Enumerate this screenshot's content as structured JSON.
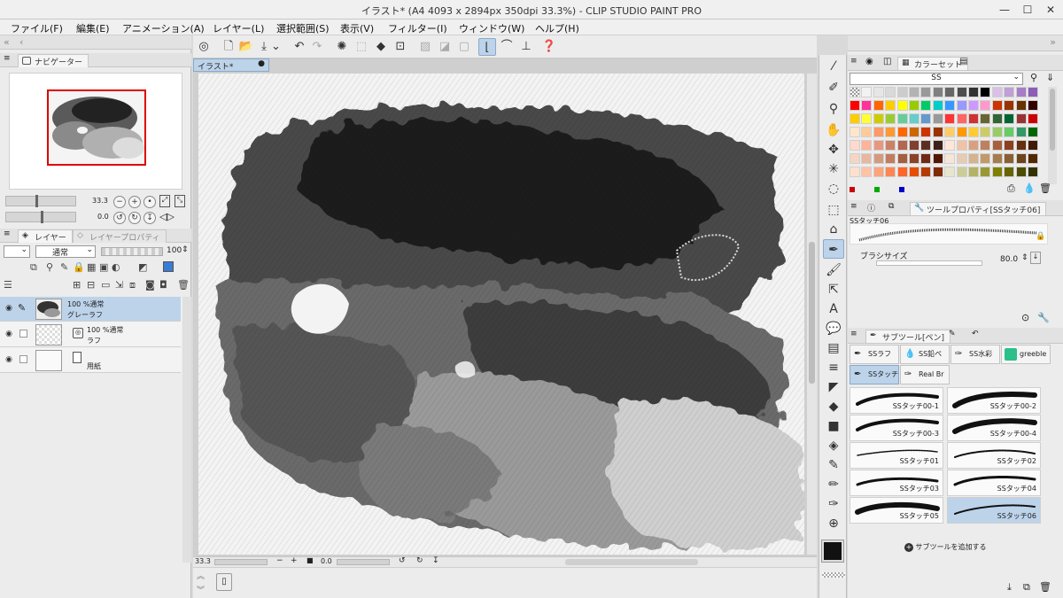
{
  "window": {
    "title": "イラスト* (A4 4093 x 2894px 350dpi 33.3%) - CLIP STUDIO PAINT PRO",
    "minimize": "—",
    "maximize": "☐",
    "close": "✕"
  },
  "menu": [
    {
      "label": "ファイル(F)"
    },
    {
      "label": "編集(E)"
    },
    {
      "label": "アニメーション(A)"
    },
    {
      "label": "レイヤー(L)"
    },
    {
      "label": "選択範囲(S)"
    },
    {
      "label": "表示(V)"
    },
    {
      "label": "フィルター(I)"
    },
    {
      "label": "ウィンドウ(W)"
    },
    {
      "label": "ヘルプ(H)"
    }
  ],
  "navigator": {
    "tab_label": "ナビゲーター",
    "zoom": "33.3",
    "rotation": "0.0"
  },
  "layers": {
    "tab_layer": "レイヤー",
    "tab_property": "レイヤープロパティ",
    "blend_mode": "通常",
    "opacity": "100",
    "items": [
      {
        "opacity_mode": "100 %通常",
        "name": "グレーラフ",
        "selected": true
      },
      {
        "opacity_mode": "100 %通常",
        "name": "ラフ",
        "selected": false
      },
      {
        "opacity_mode": "",
        "name": "用紙",
        "selected": false
      }
    ]
  },
  "canvas": {
    "doc_tab": "イラスト*",
    "zoom": "33.3",
    "angle": "0.0"
  },
  "color_set": {
    "tab_label": "カラーセット",
    "set_name": "SS",
    "colors": [
      "#ffffff",
      "#f2f2f2",
      "#e6e6e6",
      "#d9d9d9",
      "#cccccc",
      "#b3b3b3",
      "#999999",
      "#808080",
      "#666666",
      "#4d4d4d",
      "#333333",
      "#000000",
      "#d9c0e6",
      "#c09fd6",
      "#a67dc6",
      "#8c5cb6",
      "#ff0000",
      "#ff3399",
      "#ff6600",
      "#ffcc00",
      "#ffff00",
      "#99cc00",
      "#00cc66",
      "#00cccc",
      "#3399ff",
      "#9999ff",
      "#cc99ff",
      "#ff99cc",
      "#cc3300",
      "#993300",
      "#663300",
      "#330000",
      "#ffcc00",
      "#ffff33",
      "#cccc00",
      "#99cc33",
      "#66cc99",
      "#66cccc",
      "#6699cc",
      "#999999",
      "#ff3333",
      "#ff6666",
      "#cc3333",
      "#666633",
      "#336633",
      "#006633",
      "#993333",
      "#cc0000",
      "#ffe6cc",
      "#ffcc99",
      "#ff9966",
      "#ff9933",
      "#ff6600",
      "#cc6600",
      "#cc3300",
      "#993300",
      "#ffcc66",
      "#ff9900",
      "#ffcc33",
      "#cccc66",
      "#99cc66",
      "#66cc66",
      "#339966",
      "#006600",
      "#ffd9cc",
      "#ffb399",
      "#e69980",
      "#cc8066",
      "#b36650",
      "#804030",
      "#5c2e22",
      "#3d1f17",
      "#ffe6d9",
      "#f2c2a6",
      "#d9a080",
      "#bf8060",
      "#a66040",
      "#8c4020",
      "#663010",
      "#401a08",
      "#f5d6c2",
      "#e6b8a0",
      "#d49a80",
      "#c27c60",
      "#a65e40",
      "#8a4228",
      "#6e2a14",
      "#521600",
      "#f5e6d6",
      "#e6ccb3",
      "#d4b38f",
      "#c2996b",
      "#a67c4d",
      "#8a6033",
      "#6e4419",
      "#522800",
      "#ffe0cc",
      "#ffc2a3",
      "#ffa37a",
      "#ff8552",
      "#ff6629",
      "#e64d00",
      "#b33c00",
      "#802b00",
      "#e6e6cc",
      "#cccc99",
      "#b3b366",
      "#999933",
      "#808000",
      "#666600",
      "#4d4d00",
      "#333300"
    ],
    "legend_colors": [
      "#cc0000",
      "#00aa00",
      "#0000cc"
    ]
  },
  "tool_property": {
    "tab_label": "ツールプロパティ[SSタッチ06]",
    "brush_name": "SSタッチ06",
    "size_label": "ブラシサイズ",
    "size_value": "80.0"
  },
  "sub_tool": {
    "tab_label": "サブツール[ペン]",
    "groups": [
      {
        "label": "SSラフ"
      },
      {
        "label": "SS鉛ペ"
      },
      {
        "label": "SS水彩"
      },
      {
        "label": "greeble"
      },
      {
        "label": "SSタッチ"
      },
      {
        "label": "Real Br"
      }
    ],
    "brushes": [
      {
        "label": "SSタッチ00-1"
      },
      {
        "label": "SSタッチ00-2"
      },
      {
        "label": "SSタッチ00-3"
      },
      {
        "label": "SSタッチ00-4"
      },
      {
        "label": "SSタッチ01"
      },
      {
        "label": "SSタッチ02"
      },
      {
        "label": "SSタッチ03"
      },
      {
        "label": "SSタッチ04"
      },
      {
        "label": "SSタッチ05"
      },
      {
        "label": "SSタッチ06"
      }
    ],
    "add_label": "サブツールを追加する"
  }
}
